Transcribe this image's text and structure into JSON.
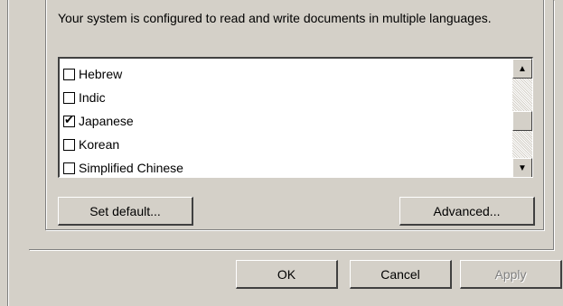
{
  "description": "Your system is configured to read and write documents in multiple languages.",
  "languages": [
    {
      "label": "Hebrew",
      "checked": false
    },
    {
      "label": "Indic",
      "checked": false
    },
    {
      "label": "Japanese",
      "checked": true
    },
    {
      "label": "Korean",
      "checked": false
    },
    {
      "label": "Simplified Chinese",
      "checked": false
    }
  ],
  "scroll_position_fraction": 0.55,
  "buttons": {
    "set_default": "Set default...",
    "advanced": "Advanced...",
    "ok": "OK",
    "cancel": "Cancel",
    "apply": "Apply"
  },
  "icons": {
    "scroll_up": "▲",
    "scroll_down": "▼",
    "check": "✔"
  }
}
